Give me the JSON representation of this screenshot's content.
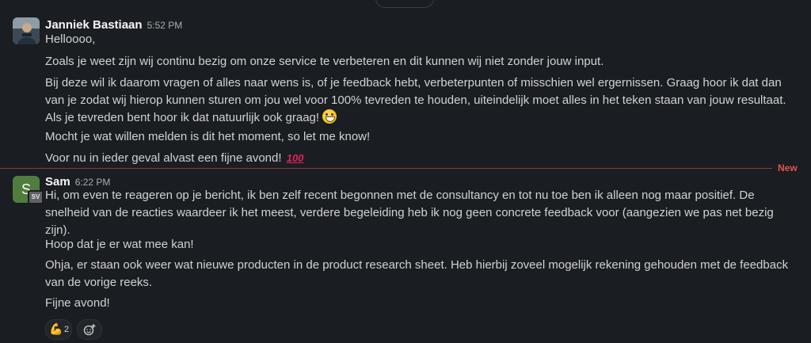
{
  "day_divider": {
    "label": ""
  },
  "messages": [
    {
      "author": "Janniek Bastiaan",
      "time": "5:52 PM",
      "paragraphs": [
        "Helloooo,",
        "Zoals je weet zijn wij continu bezig om onze service te verbeteren en dit kunnen wij niet zonder jouw input.",
        "Bij deze wil ik daarom vragen of alles naar wens is, of je feedback hebt, verbeterpunten of misschien wel ergernissen. Graag hoor ik dat dan van je zodat wij hierop kunnen sturen om jou wel voor 100% tevreden te houden, uiteindelijk moet alles in het teken staan van jouw resultaat. Als je tevreden bent hoor ik dat natuurlijk ook graag!",
        "Mocht je wat willen melden is dit het moment, so let me know!",
        "Voor nu in ieder geval alvast een fijne avond!"
      ],
      "emojis": [
        "grinning-face",
        "hundred-points"
      ]
    },
    {
      "author": "Sam",
      "time": "6:22 PM",
      "avatar_letter": "S",
      "avatar_badge": "SV",
      "paragraphs": [
        "Hi, om even te reageren op je bericht, ik ben zelf recent begonnen met de consultancy en tot nu toe ben ik alleen nog maar positief. De snelheid van de reacties waardeer ik het meest, verdere begeleiding heb ik nog geen concrete feedback voor (aangezien we pas net bezig zijn).",
        "Hoop dat je er wat mee kan!",
        "Ohja, er staan ook weer wat nieuwe producten in de product research sheet. Heb hierbij zoveel mogelijk rekening gehouden met de feedback van de vorige reeks.",
        "Fijne avond!"
      ],
      "reactions": [
        {
          "emoji": "flexed-biceps",
          "count": "2"
        }
      ]
    }
  ],
  "new_divider": {
    "label": "New"
  },
  "icons": {
    "add_reaction": "add-reaction-icon"
  },
  "colors": {
    "background": "#1a1d21",
    "text": "#d1d2d3",
    "new_accent": "#e5534b",
    "avatar_sam": "#4f7d3d"
  }
}
